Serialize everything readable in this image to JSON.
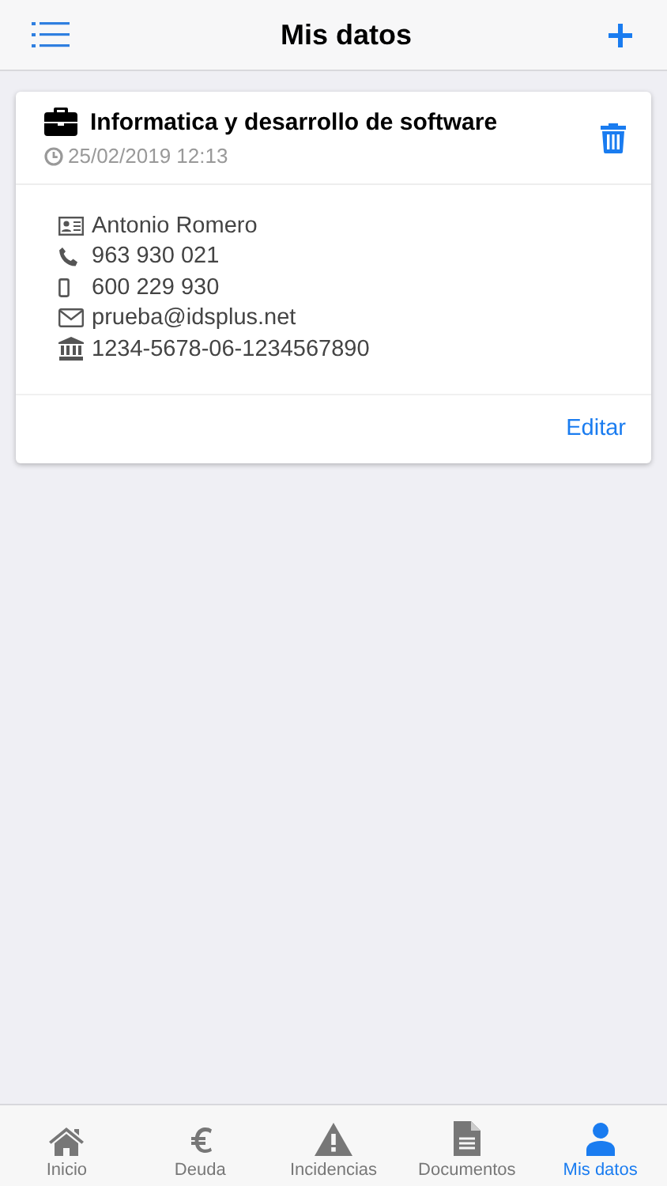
{
  "header": {
    "title": "Mis datos"
  },
  "card": {
    "title": "Informatica y desarrollo de software",
    "date": "25/02/2019 12:13",
    "details": [
      {
        "kind": "name",
        "text": "Antonio Romero"
      },
      {
        "kind": "phone",
        "text": "963 930 021"
      },
      {
        "kind": "mobile",
        "text": "600 229 930"
      },
      {
        "kind": "email",
        "text": "prueba@idsplus.net"
      },
      {
        "kind": "bank",
        "text": "1234-5678-06-1234567890"
      }
    ],
    "action": "Editar"
  },
  "tabs": [
    {
      "kind": "home",
      "label": "Inicio",
      "selected": false
    },
    {
      "kind": "euro",
      "label": "Deuda",
      "selected": false
    },
    {
      "kind": "warning",
      "label": "Incidencias",
      "selected": false
    },
    {
      "kind": "document",
      "label": "Documentos",
      "selected": false
    },
    {
      "kind": "user",
      "label": "Mis datos",
      "selected": true
    }
  ]
}
